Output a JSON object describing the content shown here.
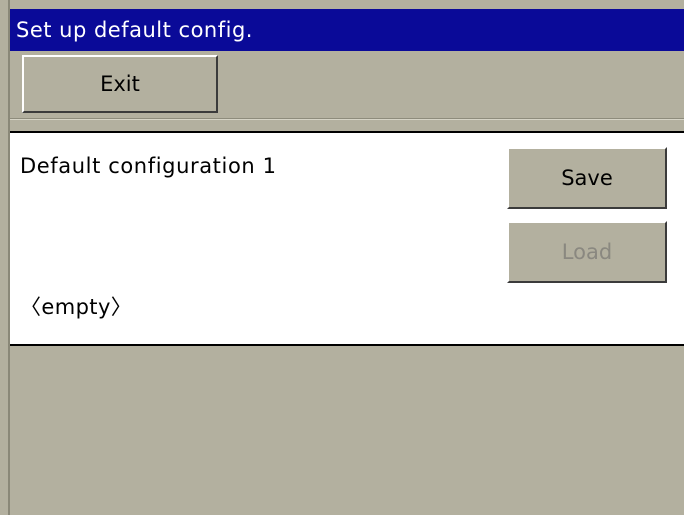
{
  "window": {
    "title": "Set up default config."
  },
  "toolbar": {
    "exit_label": "Exit"
  },
  "config": {
    "name": "Default configuration 1",
    "status": "〈empty〉",
    "save_label": "Save",
    "load_label": "Load",
    "load_enabled": false
  },
  "colors": {
    "titlebar_bg": "#0a0a98",
    "surface": "#b3b09f",
    "panel_bg": "#ffffff",
    "disabled_text": "#8a8880"
  }
}
